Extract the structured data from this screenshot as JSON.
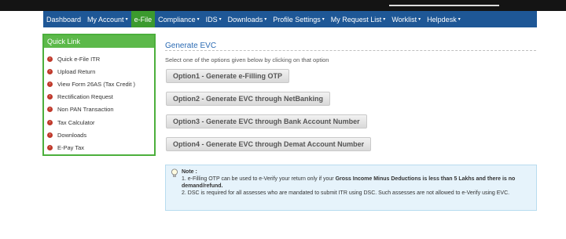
{
  "nav": {
    "items": [
      {
        "label": "Dashboard",
        "caret": false,
        "active": false
      },
      {
        "label": "My Account",
        "caret": true,
        "active": false
      },
      {
        "label": "e-File",
        "caret": false,
        "active": true
      },
      {
        "label": "Compliance",
        "caret": true,
        "active": false
      },
      {
        "label": "IDS",
        "caret": true,
        "active": false
      },
      {
        "label": "Downloads",
        "caret": true,
        "active": false
      },
      {
        "label": "Profile Settings",
        "caret": true,
        "active": false
      },
      {
        "label": "My Request List",
        "caret": true,
        "active": false
      },
      {
        "label": "Worklist",
        "caret": true,
        "active": false
      },
      {
        "label": "Helpdesk",
        "caret": true,
        "active": false
      }
    ]
  },
  "quick_link": {
    "title": "Quick Link",
    "items": [
      "Quick e-File ITR",
      "Upload Return",
      "View Form 26AS (Tax Credit )",
      "Rectification Request",
      "Non PAN Transaction",
      "Tax Calculator",
      "Downloads",
      "E-Pay Tax"
    ]
  },
  "main": {
    "title": "Generate EVC",
    "instruction": "Select one of the options given below by clicking on that option",
    "options": [
      "Option1 - Generate e-Filling OTP",
      "Option2 - Generate EVC through NetBanking",
      "Option3 - Generate EVC through Bank Account Number",
      "Option4 - Generate EVC through Demat Account Number"
    ]
  },
  "note": {
    "title": "Note :",
    "line1_pre": "1. e-Filling OTP can be used to e-Verify your return only if your ",
    "line1_bold": "Gross Income Minus Deductions is less than 5 Lakhs and there is no demand/refund.",
    "line2": "2. DSC is required for all assesses who are mandated to submit ITR using DSC. Such assesses are not allowed to e-Verify using EVC."
  },
  "colors": {
    "nav_bg": "#1e5796",
    "nav_active": "#3b9a2e",
    "quick_border": "#4caf3c",
    "title_blue": "#2a6ab3",
    "note_bg": "#e6f3fb"
  }
}
